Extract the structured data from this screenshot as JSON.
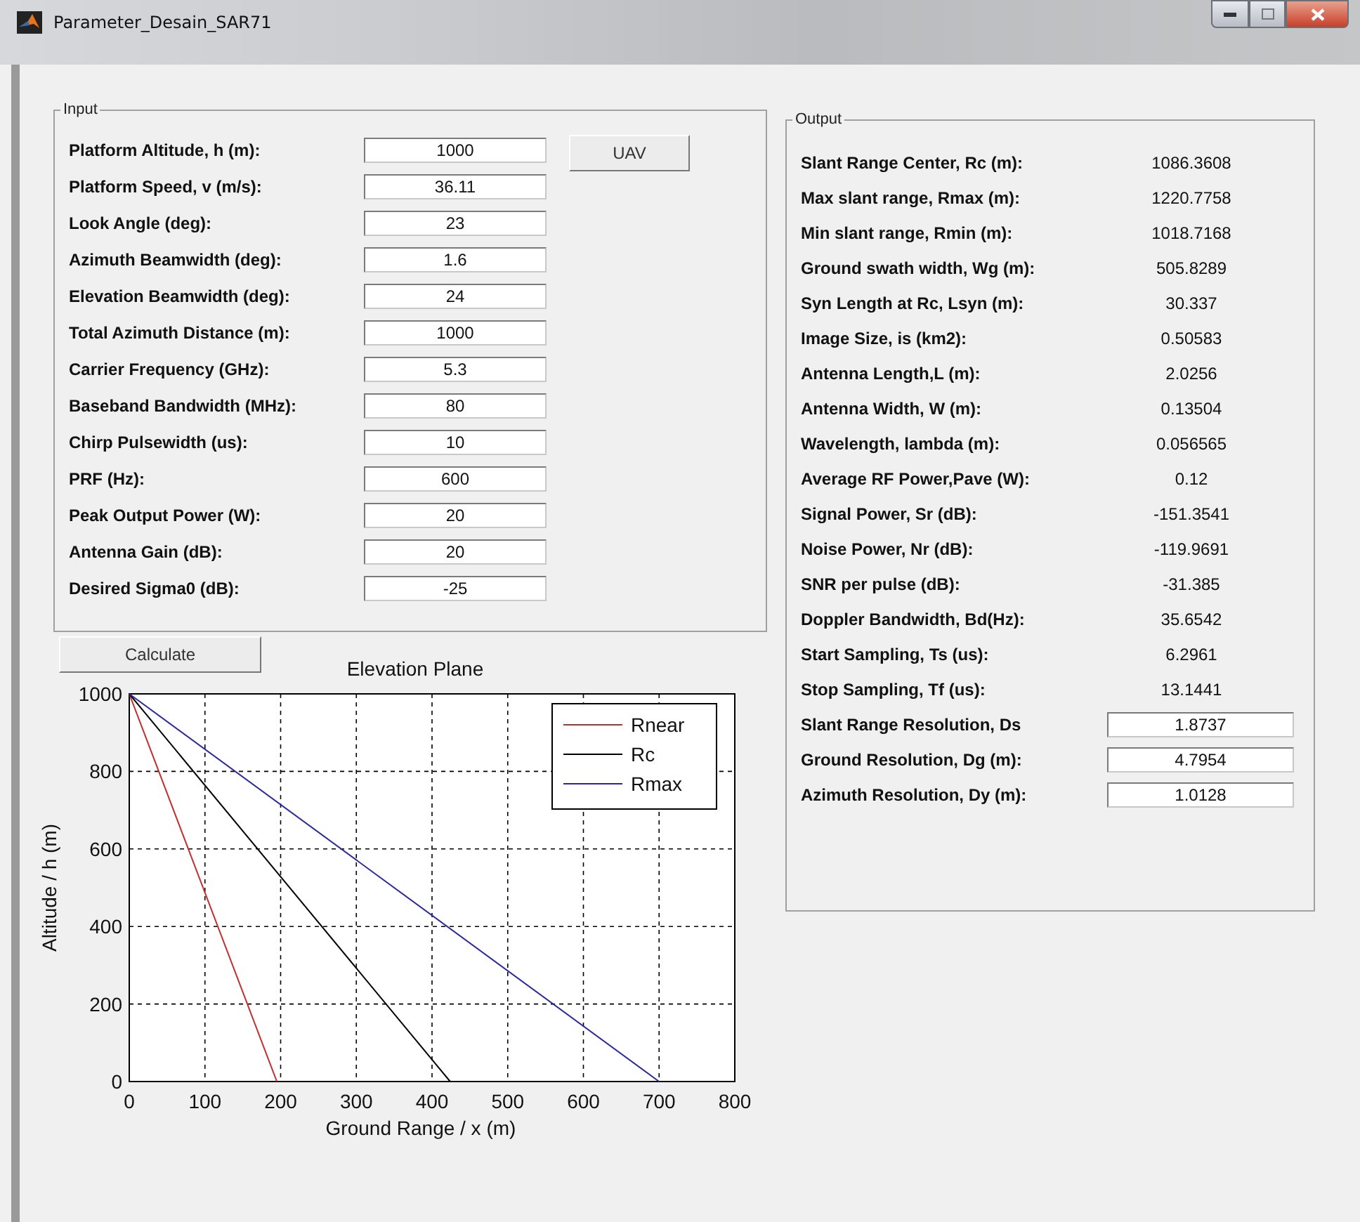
{
  "window": {
    "title": "Parameter_Desain_SAR71"
  },
  "input": {
    "title": "Input",
    "fields": [
      {
        "label": "Platform Altitude, h (m):",
        "value": "1000"
      },
      {
        "label": "Platform Speed, v (m/s):",
        "value": "36.11"
      },
      {
        "label": "Look Angle (deg):",
        "value": "23"
      },
      {
        "label": "Azimuth Beamwidth (deg):",
        "value": "1.6"
      },
      {
        "label": "Elevation Beamwidth (deg):",
        "value": "24"
      },
      {
        "label": "Total Azimuth Distance (m):",
        "value": "1000"
      },
      {
        "label": "Carrier Frequency (GHz):",
        "value": "5.3"
      },
      {
        "label": "Baseband Bandwidth (MHz):",
        "value": "80"
      },
      {
        "label": "Chirp Pulsewidth (us):",
        "value": "10"
      },
      {
        "label": "PRF (Hz):",
        "value": "600"
      },
      {
        "label": "Peak Output Power (W):",
        "value": "20"
      },
      {
        "label": "Antenna Gain (dB):",
        "value": "20"
      },
      {
        "label": "Desired Sigma0 (dB):",
        "value": "-25"
      }
    ],
    "button": "UAV"
  },
  "calculate_button": "Calculate",
  "chart": {
    "chart_data": {
      "type": "line",
      "title": "Elevation Plane",
      "xlabel": "Ground Range / x (m)",
      "ylabel": "Altitude / h (m)",
      "xlim": [
        0,
        800
      ],
      "ylim": [
        0,
        1000
      ],
      "xticks": [
        0,
        100,
        200,
        300,
        400,
        500,
        600,
        700,
        800
      ],
      "yticks": [
        0,
        200,
        400,
        600,
        800,
        1000
      ],
      "grid": true,
      "legend": true,
      "series": [
        {
          "name": "Rnear",
          "color": "#c03030",
          "x": [
            0,
            195
          ],
          "values": [
            1000,
            0
          ]
        },
        {
          "name": "Rc",
          "color": "#000000",
          "x": [
            0,
            424
          ],
          "values": [
            1000,
            0
          ]
        },
        {
          "name": "Rmax",
          "color": "#2a2a9a",
          "x": [
            0,
            700
          ],
          "values": [
            1000,
            0
          ]
        }
      ]
    }
  },
  "output": {
    "title": "Output",
    "items": [
      {
        "kind": "text",
        "label": "Slant Range Center, Rc (m):",
        "value": "1086.3608"
      },
      {
        "kind": "text",
        "label": "Max slant range, Rmax (m):",
        "value": "1220.7758"
      },
      {
        "kind": "text",
        "label": "Min slant range, Rmin (m):",
        "value": "1018.7168"
      },
      {
        "kind": "text",
        "label": "Ground swath width, Wg (m):",
        "value": "505.8289"
      },
      {
        "kind": "text",
        "label": "Syn Length at Rc, Lsyn (m):",
        "value": "30.337"
      },
      {
        "kind": "text",
        "label": "Image Size, is (km2):",
        "value": "0.50583"
      },
      {
        "kind": "text",
        "label": "Antenna Length,L (m):",
        "value": "2.0256"
      },
      {
        "kind": "text",
        "label": "Antenna Width, W (m):",
        "value": "0.13504"
      },
      {
        "kind": "text",
        "label": "Wavelength, lambda (m):",
        "value": "0.056565"
      },
      {
        "kind": "text",
        "label": "Average RF Power,Pave (W):",
        "value": "0.12"
      },
      {
        "kind": "text",
        "label": "Signal Power, Sr (dB):",
        "value": "-151.3541"
      },
      {
        "kind": "text",
        "label": "Noise Power, Nr (dB):",
        "value": "-119.9691"
      },
      {
        "kind": "text",
        "label": "SNR per pulse (dB):",
        "value": "-31.385"
      },
      {
        "kind": "text",
        "label": "Doppler Bandwidth, Bd(Hz):",
        "value": "35.6542"
      },
      {
        "kind": "text",
        "label": "Start Sampling, Ts (us):",
        "value": "6.2961"
      },
      {
        "kind": "text",
        "label": "Stop Sampling, Tf (us):",
        "value": "13.1441"
      },
      {
        "kind": "field",
        "label": "Slant Range Resolution, Ds",
        "value": "1.8737"
      },
      {
        "kind": "field",
        "label": "Ground Resolution, Dg (m):",
        "value": "4.7954"
      },
      {
        "kind": "field",
        "label": "Azimuth Resolution, Dy (m):",
        "value": "1.0128"
      }
    ]
  }
}
